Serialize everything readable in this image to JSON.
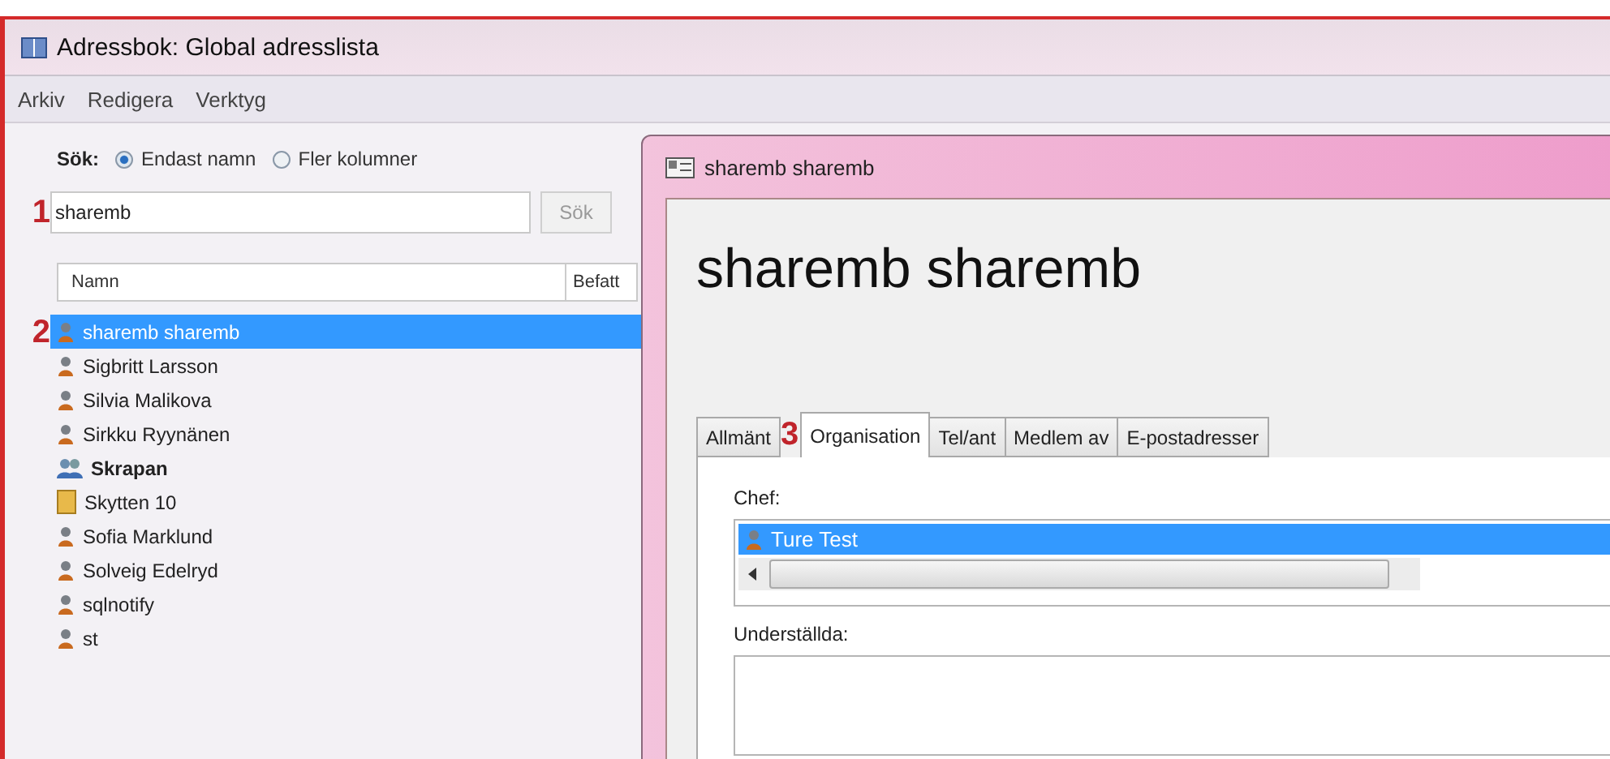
{
  "main_window": {
    "title": "Adressbok: Global adresslista",
    "menu": [
      "Arkiv",
      "Redigera",
      "Verktyg"
    ],
    "search": {
      "label": "Sök:",
      "options": [
        {
          "label": "Endast namn",
          "selected": true
        },
        {
          "label": "Fler kolumner",
          "selected": false
        }
      ],
      "marker": "1",
      "value": "sharemb",
      "button": "Sök"
    },
    "columns": [
      "Namn",
      "Befatt"
    ],
    "list_marker": "2",
    "entries": [
      {
        "name": "sharemb sharemb",
        "kind": "user",
        "selected": true
      },
      {
        "name": "Sigbritt Larsson",
        "kind": "user",
        "selected": false
      },
      {
        "name": "Silvia Malikova",
        "kind": "user",
        "selected": false
      },
      {
        "name": "Sirkku Ryynänen",
        "kind": "user",
        "selected": false
      },
      {
        "name": "Skrapan",
        "kind": "group",
        "selected": false
      },
      {
        "name": "Skytten 10",
        "kind": "folder",
        "selected": false
      },
      {
        "name": "Sofia Marklund",
        "kind": "user",
        "selected": false
      },
      {
        "name": "Solveig Edelryd",
        "kind": "user",
        "selected": false
      },
      {
        "name": "sqlnotify",
        "kind": "user",
        "selected": false
      },
      {
        "name": "st",
        "kind": "user",
        "selected": false
      }
    ]
  },
  "dialog": {
    "title": "sharemb sharemb",
    "heading": "sharemb sharemb",
    "tabs": [
      {
        "label": "Allmänt",
        "selected": false
      },
      {
        "label": "Organisation",
        "selected": true
      },
      {
        "label": "Tel/ant",
        "selected": false
      },
      {
        "label": "Medlem av",
        "selected": false
      },
      {
        "label": "E-postadresser",
        "selected": false
      }
    ],
    "tab_marker": "3",
    "manager_label": "Chef:",
    "managers": [
      {
        "name": "Ture Test",
        "kind": "user",
        "selected": true
      }
    ],
    "reports_label": "Underställda:"
  }
}
